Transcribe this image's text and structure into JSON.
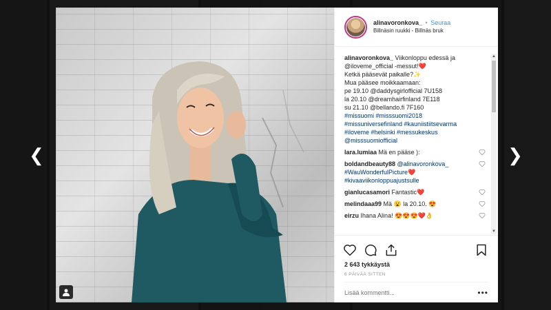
{
  "nav": {
    "prev_glyph": "❮",
    "next_glyph": "❯"
  },
  "header": {
    "username": "alinavoronkova_",
    "separator": "•",
    "follow_label": "Seuraa",
    "location": "Billnäsin ruukki - Billnäs bruk"
  },
  "caption": {
    "author": "alinavoronkova_",
    "lines": [
      "Viikonloppu edessä ja",
      "@iloveme_official -messut!❤️",
      "Ketkä pääsevät paikalle?✨",
      "Mua pääsee moikkaamaan:",
      "pe 19.10 @daddysgirlofficial 7U158",
      "la 20.10 @dreamhairfinland 7E118",
      "su 21.10 @bellando.fi 7F160",
      "#missuomi #misssuomi2018",
      "#missuniversefinland #kauniistiitsevarma",
      "#iloveme #helsinki #messukeskus",
      "@misssuomiofficial"
    ]
  },
  "comments": [
    {
      "user": "lara.lumiaa",
      "text": "Mä en pääse ):"
    },
    {
      "user": "boldandbeauty88",
      "text": "@alinavoronkova_ #WauWonderfulPicture❤️ #kivaaviikonloppuajustsulle"
    },
    {
      "user": "gianlucasamori",
      "text": "Fantastic❤️"
    },
    {
      "user": "melindaaa99",
      "text": "Mä 😮 la 20.10. 😍"
    },
    {
      "user": "eirzu",
      "text": "Ihana Alina! 😍😍😍❤️👌"
    }
  ],
  "actions": {
    "like_icon": "heart-icon",
    "comment_icon": "comment-icon",
    "share_icon": "share-icon",
    "save_icon": "bookmark-icon"
  },
  "likes_text": "2 643 tykkäystä",
  "time_text": "6 PÄIVÄÄ SITTEN",
  "add_comment_placeholder": "Lisää kommentti...",
  "more_glyph": "•••",
  "colors": {
    "follow": "#3897f0",
    "hashtag": "#003569",
    "avatar_ring": "#c13584",
    "sweater": "#1f5a63"
  }
}
